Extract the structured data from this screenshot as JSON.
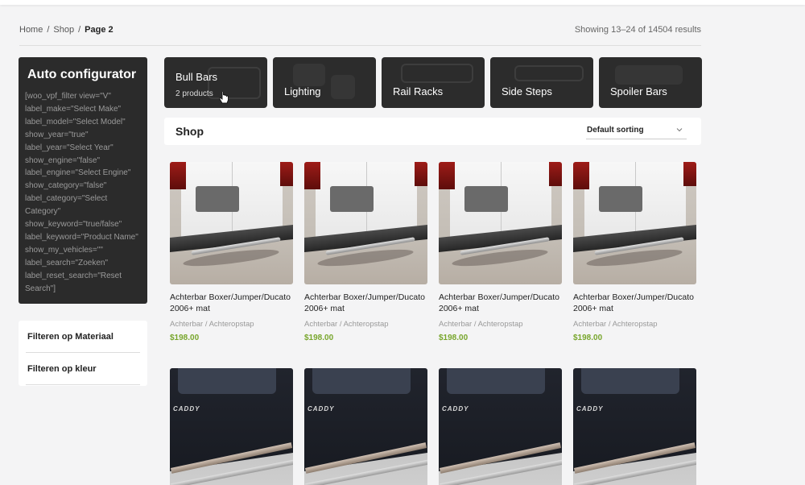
{
  "breadcrumb": {
    "home": "Home",
    "sep1": "/",
    "shop": "Shop",
    "sep2": "/",
    "current": "Page 2"
  },
  "results_text": "Showing 13–24 of 14504 results",
  "configurator": {
    "title": "Auto configurator",
    "code": "[woo_vpf_filter view=\"V\" label_make=\"Select Make\" label_model=\"Select Model\" show_year=\"true\" label_year=\"Select Year\" show_engine=\"false\" label_engine=\"Select Engine\" show_category=\"false\" label_category=\"Select Category\" show_keyword=\"true/false\" label_keyword=\"Product Name\" show_my_vehicles=\"\" label_search=\"Zoeken\" label_reset_search=\"Reset Search\"]"
  },
  "filters": [
    {
      "label": "Filteren op Materiaal"
    },
    {
      "label": "Filteren op kleur"
    }
  ],
  "categories": [
    {
      "label": "Bull Bars",
      "sub": "2 products"
    },
    {
      "label": "Lighting"
    },
    {
      "label": "Rail Racks"
    },
    {
      "label": "Side Steps"
    },
    {
      "label": "Spoiler Bars"
    }
  ],
  "shop": {
    "title": "Shop",
    "sorting": "Default sorting"
  },
  "products": [
    {
      "name": "Achterbar Boxer/Jumper/Ducato 2006+ mat",
      "category": "Achterbar / Achteropstap",
      "price": "$198.00"
    },
    {
      "name": "Achterbar Boxer/Jumper/Ducato 2006+ mat",
      "category": "Achterbar / Achteropstap",
      "price": "$198.00"
    },
    {
      "name": "Achterbar Boxer/Jumper/Ducato 2006+ mat",
      "category": "Achterbar / Achteropstap",
      "price": "$198.00"
    },
    {
      "name": "Achterbar Boxer/Jumper/Ducato 2006+ mat",
      "category": "Achterbar / Achteropstap",
      "price": "$198.00"
    }
  ],
  "caddy_badge": "CADDY",
  "colors": {
    "price": "#78a62c",
    "dark_card": "#2c2c2c"
  }
}
